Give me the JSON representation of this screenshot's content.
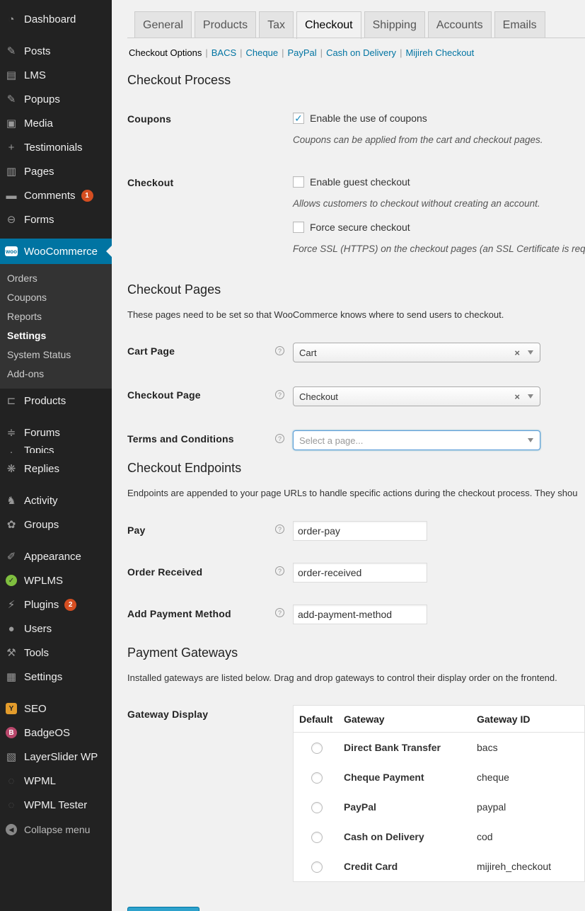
{
  "sidebar": {
    "dashboard": "Dashboard",
    "posts": "Posts",
    "lms": "LMS",
    "popups": "Popups",
    "media": "Media",
    "testimonials": "Testimonials",
    "pages": "Pages",
    "comments": "Comments",
    "comments_badge": "1",
    "forms": "Forms",
    "woocommerce": "WooCommerce",
    "woo_logo_text": "woo",
    "submenu": [
      "Orders",
      "Coupons",
      "Reports",
      "Settings",
      "System Status",
      "Add-ons"
    ],
    "products": "Products",
    "forums": "Forums",
    "topics_partial": "Topics",
    "replies": "Replies",
    "activity": "Activity",
    "groups": "Groups",
    "appearance": "Appearance",
    "wplms": "WPLMS",
    "plugins": "Plugins",
    "plugins_badge": "2",
    "users": "Users",
    "tools": "Tools",
    "settings": "Settings",
    "seo": "SEO",
    "badgeos": "BadgeOS",
    "layerslider": "LayerSlider WP",
    "wpml": "WPML",
    "wpml_tester": "WPML Tester",
    "collapse": "Collapse menu"
  },
  "tabs": [
    "General",
    "Products",
    "Tax",
    "Checkout",
    "Shipping",
    "Accounts",
    "Emails"
  ],
  "subsub": {
    "current": "Checkout Options",
    "links": [
      "BACS",
      "Cheque",
      "PayPal",
      "Cash on Delivery",
      "Mijireh Checkout"
    ]
  },
  "checkout_process": {
    "title": "Checkout Process",
    "coupons_label": "Coupons",
    "coupons_checkbox": "Enable the use of coupons",
    "coupons_checked": true,
    "coupons_hint": "Coupons can be applied from the cart and checkout pages.",
    "checkout_label": "Checkout",
    "guest_checkbox": "Enable guest checkout",
    "guest_hint": "Allows customers to checkout without creating an account.",
    "secure_checkbox": "Force secure checkout",
    "secure_hint": "Force SSL (HTTPS) on the checkout pages (an SSL Certificate is requ"
  },
  "checkout_pages": {
    "title": "Checkout Pages",
    "description": "These pages need to be set so that WooCommerce knows where to send users to checkout.",
    "cart_label": "Cart Page",
    "cart_value": "Cart",
    "checkout_label": "Checkout Page",
    "checkout_value": "Checkout",
    "terms_label": "Terms and Conditions",
    "terms_placeholder": "Select a page..."
  },
  "checkout_endpoints": {
    "title": "Checkout Endpoints",
    "description": "Endpoints are appended to your page URLs to handle specific actions during the checkout process. They shou",
    "pay_label": "Pay",
    "pay_value": "order-pay",
    "received_label": "Order Received",
    "received_value": "order-received",
    "add_payment_label": "Add Payment Method",
    "add_payment_value": "add-payment-method"
  },
  "payment_gateways": {
    "title": "Payment Gateways",
    "description": "Installed gateways are listed below. Drag and drop gateways to control their display order on the frontend.",
    "display_label": "Gateway Display",
    "columns": [
      "Default",
      "Gateway",
      "Gateway ID"
    ],
    "rows": [
      {
        "name": "Direct Bank Transfer",
        "id": "bacs"
      },
      {
        "name": "Cheque Payment",
        "id": "cheque"
      },
      {
        "name": "PayPal",
        "id": "paypal"
      },
      {
        "name": "Cash on Delivery",
        "id": "cod"
      },
      {
        "name": "Credit Card",
        "id": "mijireh_checkout"
      }
    ]
  },
  "help_glyph": "?",
  "colors": {
    "sidebar_bg": "#222222",
    "active_bg": "#0074a2",
    "link": "#0074a2",
    "badge": "#d54e21",
    "primary_button": "#2ea2cc"
  }
}
